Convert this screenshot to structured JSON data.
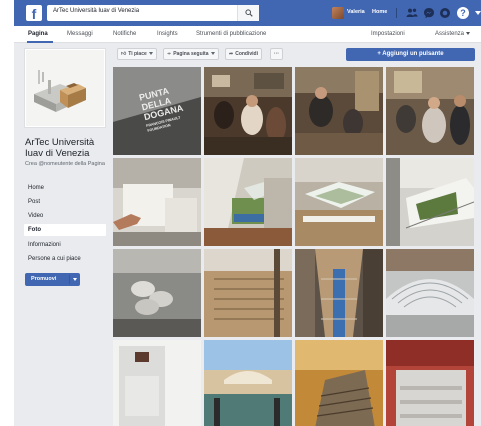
{
  "topbar": {
    "search_value": "ArTec Università Iuav di Venezia",
    "user_name": "Valeria",
    "home_label": "Home",
    "help_glyph": "?",
    "icons": [
      "facebook-logo-icon",
      "search-icon",
      "friend-requests-icon",
      "messages-icon",
      "notifications-icon",
      "help-icon",
      "account-menu-icon"
    ],
    "brand_color": "#4267b2"
  },
  "tabs": {
    "items": [
      {
        "label": "Pagina",
        "active": true
      },
      {
        "label": "Messaggi"
      },
      {
        "label": "Notifiche"
      },
      {
        "label": "Insights"
      },
      {
        "label": "Strumenti di pubblicazione"
      },
      {
        "label": "Impostazioni"
      },
      {
        "label": "Assistenza"
      }
    ]
  },
  "profile": {
    "page_name": "ArTec Università Iuav di Venezia",
    "username_prompt": "Crea @nomeutente della Pagina"
  },
  "sidebar": {
    "items": [
      {
        "label": "Home"
      },
      {
        "label": "Post"
      },
      {
        "label": "Video"
      },
      {
        "label": "Foto",
        "active": true
      },
      {
        "label": "Informazioni"
      },
      {
        "label": "Persone a cui piace"
      }
    ],
    "promote_label": "Promuovi"
  },
  "actions": {
    "like_label": "Ti piace",
    "follow_label": "Pagina seguita",
    "share_label": "Condividi",
    "more_label": "···",
    "cta_label": "+ Aggiungi un pulsante"
  },
  "photos": {
    "count": 16,
    "top_left_sign_text": [
      "PUNTA",
      "DELLA",
      "DOGANA",
      "FRANCOIS PINAULT",
      "FOUNDATION"
    ]
  }
}
